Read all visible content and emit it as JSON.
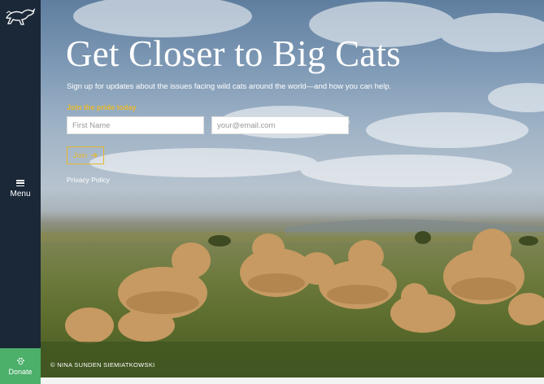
{
  "sidebar": {
    "logo_icon": "leaping-cat-logo",
    "menu_icon": "hamburger-icon",
    "menu_label": "Menu",
    "donate_icon": "paw-icon",
    "donate_label": "Donate",
    "background": "#1b2838",
    "donate_color": "#4caf6a"
  },
  "hero": {
    "headline": "Get Closer to Big Cats",
    "subline": "Sign up for updates about the issues facing wild cats around the world—and how you can help.",
    "form": {
      "label": "Join the pride today",
      "first_name_placeholder": "First Name",
      "email_placeholder": "your@email.com",
      "join_label": "Join",
      "join_icon": "arrow-right-icon"
    },
    "privacy_link": "Privacy Policy",
    "photo_credit": "© NINA SUNDEN SIEMIATKOWSKI",
    "accent_color": "#e8b92e",
    "photo_subject": "pride of lions resting in savanna grass"
  }
}
